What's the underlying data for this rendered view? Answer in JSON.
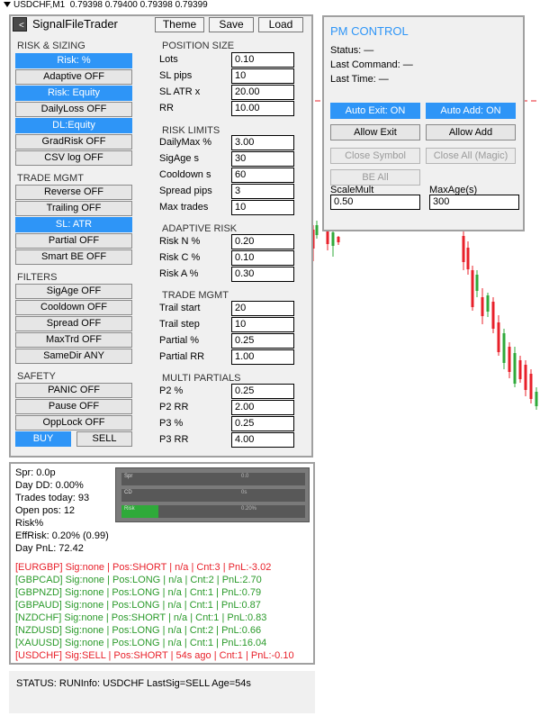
{
  "chart_header": {
    "symbol_timeframe": "USDCHF,M1",
    "ohlc": "0.79398 0.79400 0.79398 0.79399"
  },
  "colors": {
    "accent": "#2e95f7",
    "bull": "#2faa3a",
    "bear": "#e8202a",
    "pnl_neg": "#e8202a",
    "pnl_pos": "#2a9a2a"
  },
  "panel": {
    "collapse": "<",
    "title": "SignalFileTrader",
    "theme_label": "Theme",
    "save_label": "Save",
    "load_label": "Load"
  },
  "sections": {
    "risk_sizing": "RISK & SIZING",
    "trade_mgmt": "TRADE MGMT",
    "filters": "FILTERS",
    "safety": "SAFETY",
    "position_size": "POSITION SIZE",
    "risk_limits": "RISK LIMITS",
    "adaptive_risk": "ADAPTIVE RISK",
    "trade_mgmt_r": "TRADE MGMT",
    "multi_partials": "MULTI PARTIALS"
  },
  "toggles": {
    "risk_pct": "Risk: %",
    "adaptive": "Adaptive OFF",
    "risk_equity": "Risk: Equity",
    "daily_loss": "DailyLoss OFF",
    "dl_equity": "DL:Equity",
    "grad_risk": "GradRisk OFF",
    "csv_log": "CSV log OFF",
    "reverse": "Reverse OFF",
    "trailing": "Trailing OFF",
    "sl_atr": "SL: ATR",
    "partial": "Partial OFF",
    "smart_be": "Smart BE OFF",
    "sig_age": "SigAge OFF",
    "cooldown": "Cooldown OFF",
    "spread": "Spread OFF",
    "max_trd": "MaxTrd OFF",
    "same_dir": "SameDir ANY",
    "panic": "PANIC OFF",
    "pause": "Pause OFF",
    "opp_lock": "OppLock OFF",
    "buy": "BUY",
    "sell": "SELL"
  },
  "fields": {
    "lots": {
      "label": "Lots",
      "value": "0.10"
    },
    "sl_pips": {
      "label": "SL pips",
      "value": "10"
    },
    "sl_atr_x": {
      "label": "SL ATR x",
      "value": "20.00"
    },
    "rr": {
      "label": "RR",
      "value": "10.00"
    },
    "daily_max": {
      "label": "DailyMax %",
      "value": "3.00"
    },
    "sig_age_s": {
      "label": "SigAge s",
      "value": "30"
    },
    "cooldown_s": {
      "label": "Cooldown s",
      "value": "60"
    },
    "spread_pips": {
      "label": "Spread pips",
      "value": "3"
    },
    "max_trades": {
      "label": "Max trades",
      "value": "10"
    },
    "risk_n": {
      "label": "Risk N %",
      "value": "0.20"
    },
    "risk_c": {
      "label": "Risk C %",
      "value": "0.10"
    },
    "risk_a": {
      "label": "Risk A %",
      "value": "0.30"
    },
    "trail_start": {
      "label": "Trail start",
      "value": "20"
    },
    "trail_step": {
      "label": "Trail step",
      "value": "10"
    },
    "partial_pct": {
      "label": "Partial %",
      "value": "0.25"
    },
    "partial_rr": {
      "label": "Partial RR",
      "value": "1.00"
    },
    "p2_pct": {
      "label": "P2 %",
      "value": "0.25"
    },
    "p2_rr": {
      "label": "P2 RR",
      "value": "2.00"
    },
    "p3_pct": {
      "label": "P3 %",
      "value": "0.25"
    },
    "p3_rr": {
      "label": "P3 RR",
      "value": "4.00"
    }
  },
  "stats": {
    "spr": "Spr: 0.0p",
    "day_dd": "Day DD:  0.00%",
    "trades_today": "Trades today: 93",
    "open_pos": "Open pos: 12",
    "risk_mode": "Risk%",
    "eff_risk": "EffRisk: 0.20% (0.99)",
    "day_pnl": "Day PnL: 72.42"
  },
  "meters": [
    {
      "label": "Spr",
      "value": "0.0",
      "fill": 0
    },
    {
      "label": "CD",
      "value": "0s",
      "fill": 0
    },
    {
      "label": "Risk",
      "value": "0.20%",
      "fill": 0.2
    }
  ],
  "symbols": [
    {
      "text": "[EURGBP] Sig:none | Pos:SHORT | n/a  | Cnt:3 | PnL:-3.02",
      "tone": "neg"
    },
    {
      "text": "[GBPCAD] Sig:none | Pos:LONG | n/a  | Cnt:2 | PnL:2.70",
      "tone": "pos"
    },
    {
      "text": "[GBPNZD] Sig:none | Pos:LONG | n/a  | Cnt:1 | PnL:0.79",
      "tone": "pos"
    },
    {
      "text": "[GBPAUD] Sig:none | Pos:LONG | n/a  | Cnt:1 | PnL:0.87",
      "tone": "pos"
    },
    {
      "text": "[NZDCHF] Sig:none | Pos:SHORT | n/a  | Cnt:1 | PnL:0.83",
      "tone": "pos"
    },
    {
      "text": "[NZDUSD] Sig:none | Pos:LONG | n/a  | Cnt:2 | PnL:0.66",
      "tone": "pos"
    },
    {
      "text": "[XAUUSD] Sig:none | Pos:LONG | n/a  | Cnt:1 | PnL:16.04",
      "tone": "pos"
    },
    {
      "text": "[USDCHF] Sig:SELL | Pos:SHORT | 54s ago  | Cnt:1 | PnL:-0.10",
      "tone": "neg"
    }
  ],
  "status_bar": "STATUS: RUNInfo: USDCHF  LastSig=SELL  Age=54s",
  "pm": {
    "title": "PM CONTROL",
    "status": "Status: —",
    "last_command": "Last Command: —",
    "last_time": "Last Time: —",
    "auto_exit": "Auto Exit: ON",
    "auto_add": "Auto Add: ON",
    "allow_exit": "Allow Exit",
    "allow_add": "Allow Add",
    "close_symbol": "Close Symbol",
    "close_all": "Close All (Magic)",
    "be_all": "BE All",
    "scale_mult_label": "ScaleMult",
    "scale_mult_value": "0.50",
    "max_age_label": "MaxAge(s)",
    "max_age_value": "300"
  }
}
